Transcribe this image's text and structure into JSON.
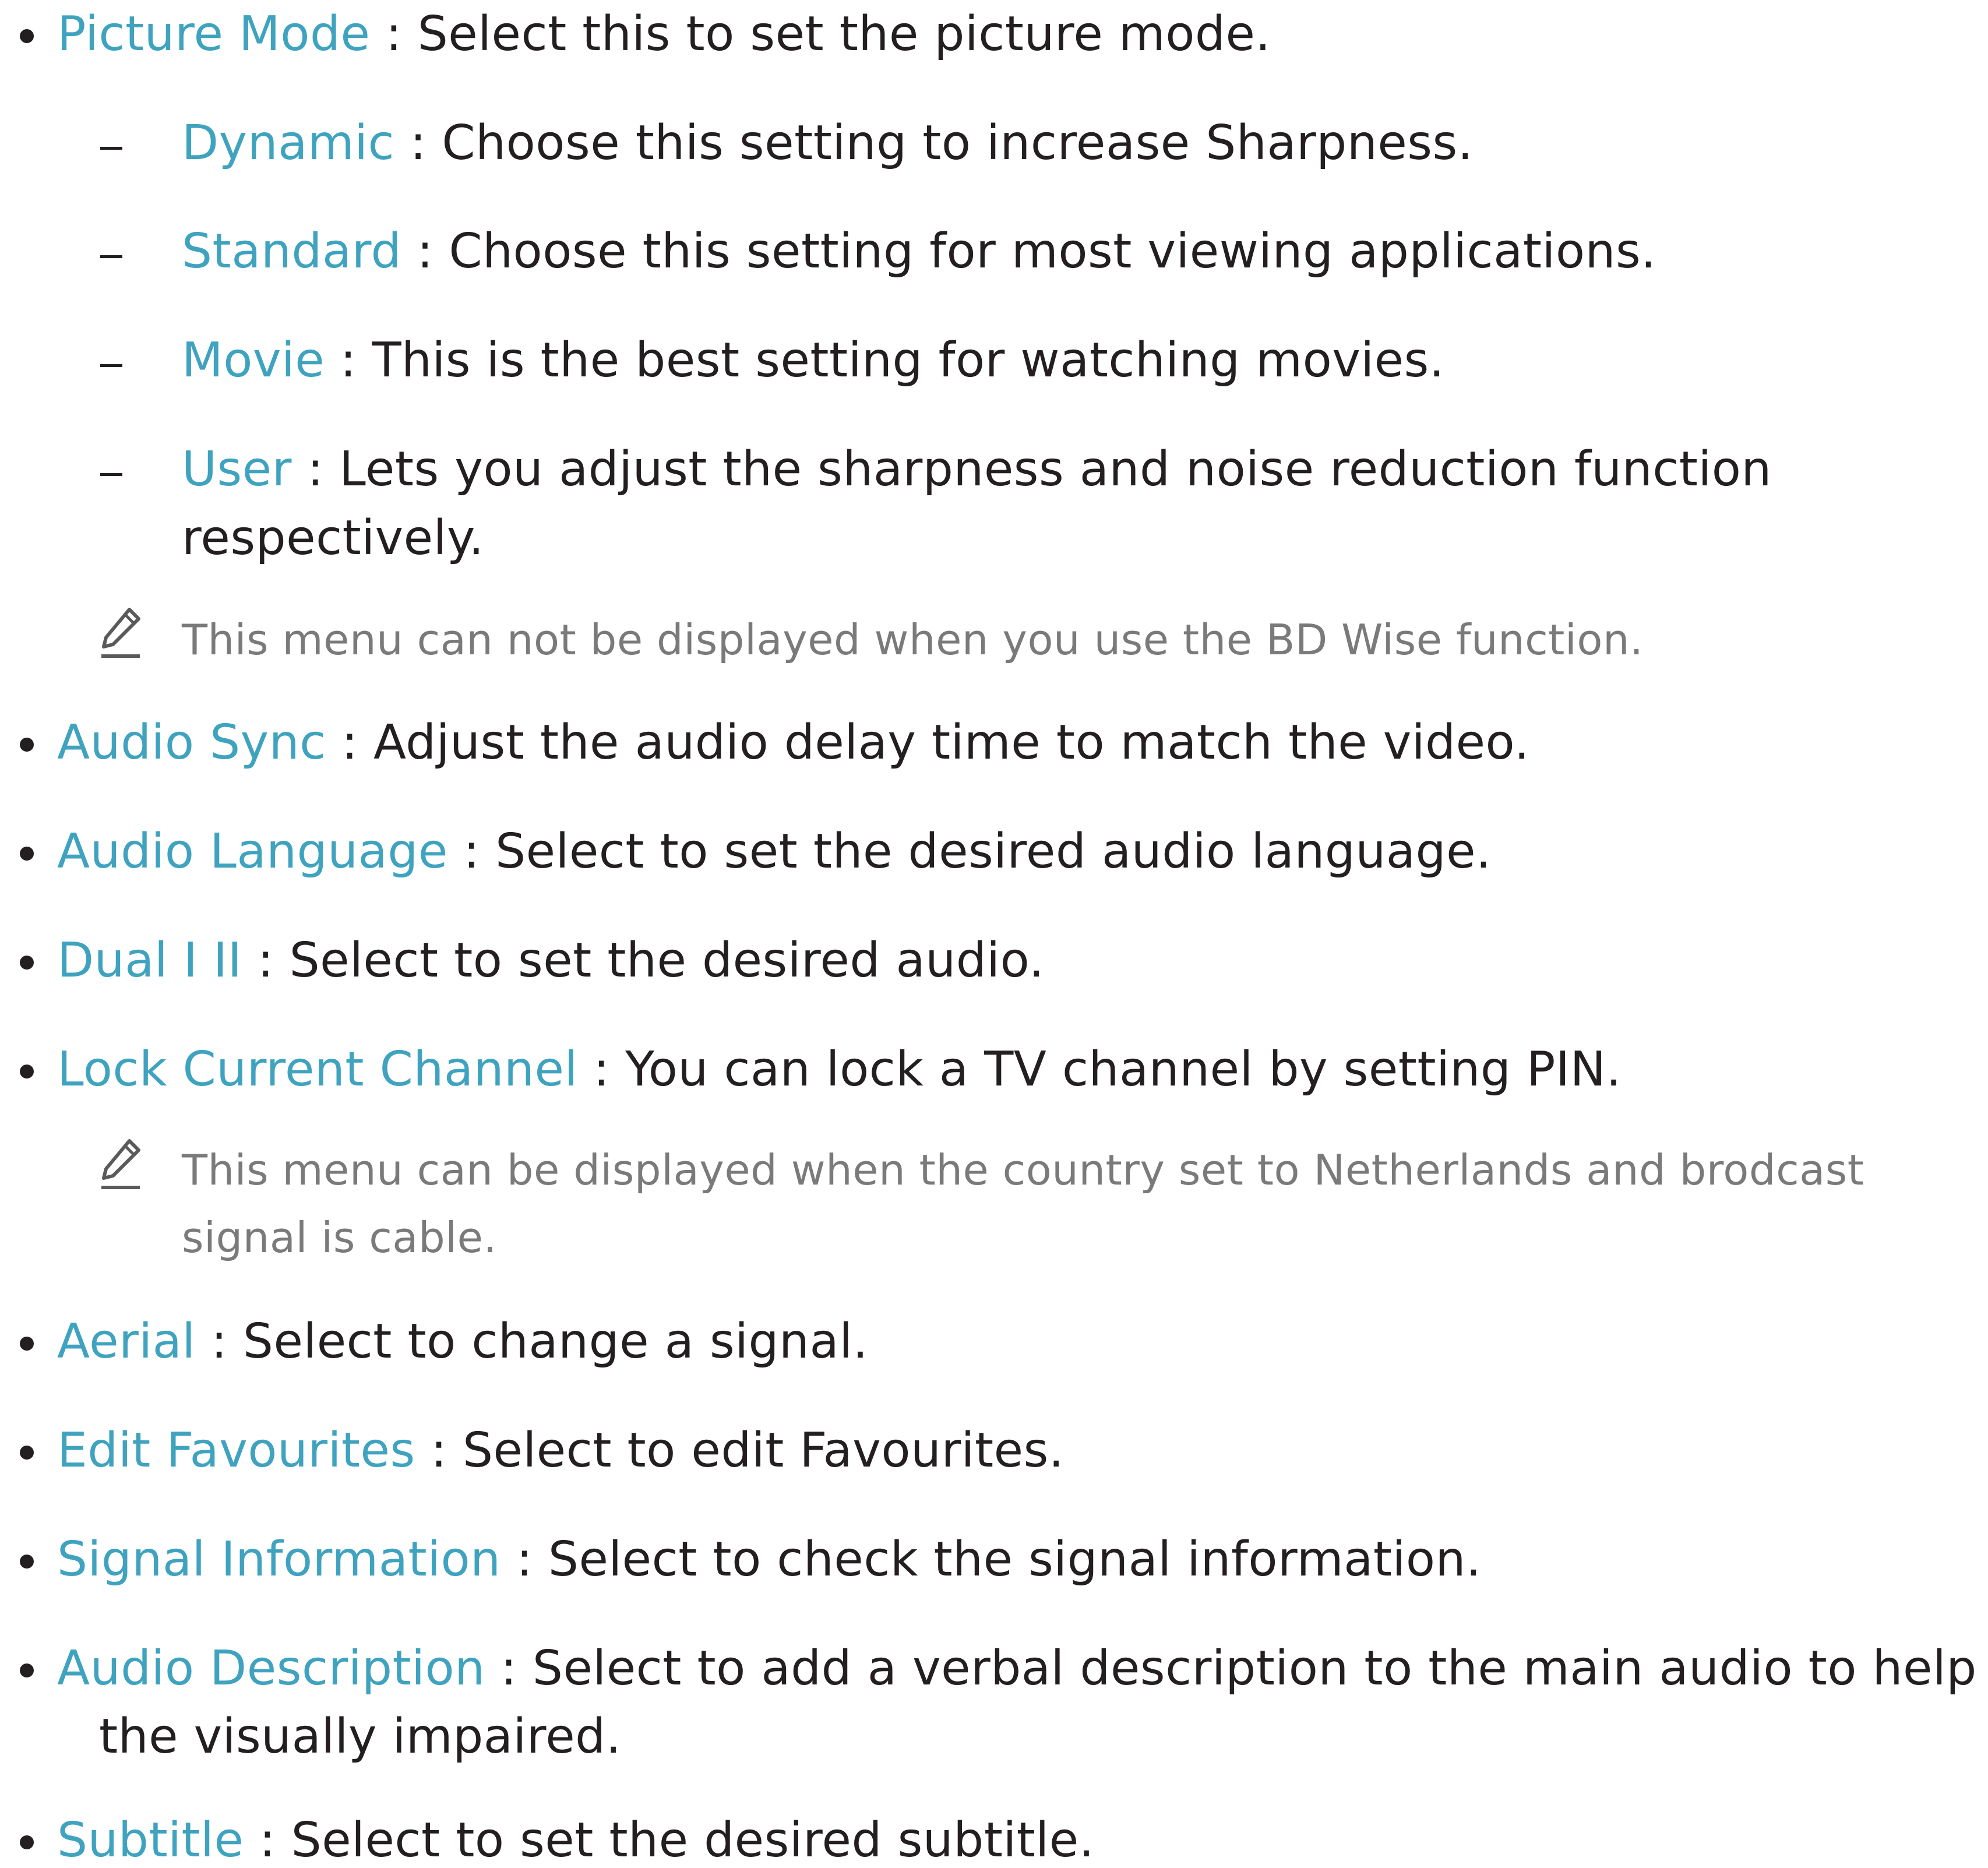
{
  "colors": {
    "term": "#3fa3bf",
    "body_text": "#231f20",
    "note_text": "#7a7a7a"
  },
  "items": {
    "picture_mode": {
      "term": "Picture Mode",
      "sep": " : ",
      "desc": "Select this to set the picture mode.",
      "sub": [
        {
          "term": "Dynamic",
          "sep": " : ",
          "desc": "Choose this setting to increase Sharpness."
        },
        {
          "term": "Standard",
          "sep": " : ",
          "desc": "Choose this setting for most viewing applications."
        },
        {
          "term": "Movie",
          "sep": " : ",
          "desc": "This is the best setting for watching movies."
        },
        {
          "term": "User",
          "sep": " : ",
          "desc": "Lets you adjust the sharpness and noise reduction function",
          "desc_cont": "respectively."
        }
      ],
      "note": "This menu can not be displayed when you use the BD Wise function.",
      "note_icon": "pencil-icon"
    },
    "audio_sync": {
      "term": "Audio Sync",
      "sep": " : ",
      "desc": "Adjust the audio delay time to match the video."
    },
    "audio_language": {
      "term": "Audio Language",
      "sep": " : ",
      "desc": "Select to set the desired audio language."
    },
    "dual": {
      "term": "Dual I II",
      "sep": " : ",
      "desc": "Select to set the desired audio."
    },
    "lock_channel": {
      "term": "Lock Current Channel",
      "sep": " : ",
      "desc": "You can lock a TV channel by setting PIN.",
      "note": "This menu can be displayed when the country set to Netherlands and brodcast",
      "note_cont": "signal is cable.",
      "note_icon": "pencil-icon"
    },
    "aerial": {
      "term": "Aerial",
      "sep": " : ",
      "desc": "Select to change a signal."
    },
    "edit_favourites": {
      "term": "Edit Favourites",
      "sep": " : ",
      "desc": "Select to edit Favourites."
    },
    "signal_information": {
      "term": "Signal Information",
      "sep": " : ",
      "desc": "Select to check the signal information."
    },
    "audio_description": {
      "term": "Audio Description",
      "sep": " : ",
      "desc": "Select to add a verbal description to the main audio to help",
      "desc_cont": "the visually impaired."
    },
    "subtitle": {
      "term": "Subtitle",
      "sep": " : ",
      "desc": "Select to set the desired subtitle."
    }
  }
}
